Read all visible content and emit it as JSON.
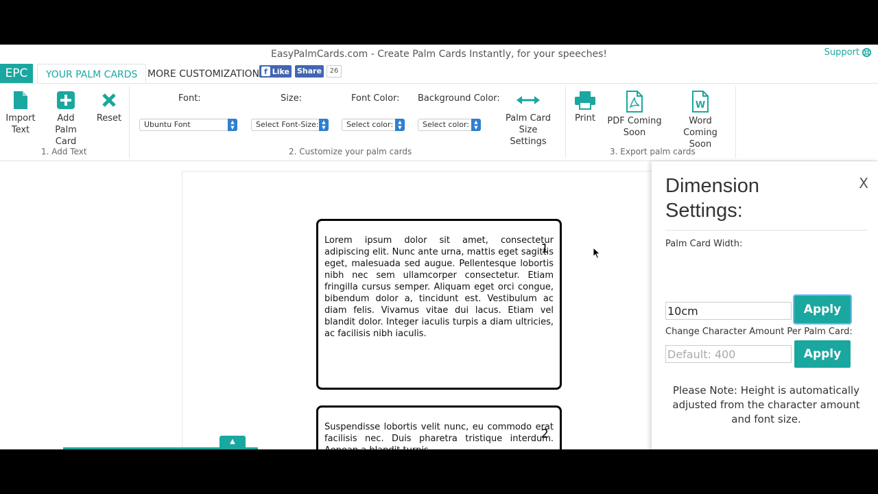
{
  "window": {
    "title": "EasyPalmCards.com - Create Palm Cards Instantly, for your speeches!",
    "support_label": "Support"
  },
  "tabs": {
    "logo": "EPC",
    "items": [
      {
        "label": "YOUR PALM CARDS",
        "active": true
      },
      {
        "label": "MORE CUSTOMIZATION",
        "active": false
      }
    ],
    "facebook": {
      "like": "Like",
      "share": "Share",
      "count": "26"
    }
  },
  "ribbon": {
    "add_text_group": {
      "label": "1. Add Text",
      "tools": [
        {
          "label": "Import Text",
          "icon": "file-icon"
        },
        {
          "label": "Add Palm Card",
          "icon": "plus-square-icon"
        },
        {
          "label": "Reset",
          "icon": "x-icon"
        }
      ]
    },
    "customize_group": {
      "label": "2. Customize your palm cards",
      "font": {
        "label": "Font:",
        "value": "Ubuntu Font"
      },
      "size": {
        "label": "Size:",
        "value": "Select Font-Size:"
      },
      "font_color": {
        "label": "Font Color:",
        "value": "Select color:"
      },
      "background_color": {
        "label": "Background Color:",
        "value": "Select color:"
      },
      "size_settings": {
        "label": "Palm Card Size Settings",
        "icon": "arrows-horizontal-icon"
      }
    },
    "export_group": {
      "label": "3. Export palm cards",
      "tools": [
        {
          "label": "Print",
          "icon": "print-icon"
        },
        {
          "label": "PDF Coming Soon",
          "icon": "pdf-file-icon"
        },
        {
          "label": "Word Coming Soon",
          "icon": "word-file-icon"
        }
      ]
    }
  },
  "cards": [
    {
      "number": "1",
      "text": "Lorem ipsum dolor sit amet, consectetur adipiscing elit. Nunc ante urna, mattis eget sagittis eget, malesuada sed augue. Pellentesque lobortis nibh nec sem ullamcorper consectetur. Etiam fringilla cursus semper. Aliquam eget orci congue, bibendum dolor a, tincidunt est. Vestibulum ac diam felis. Vivamus vitae dui lacus. Etiam vel blandit dolor. Integer iaculis turpis a diam ultricies, ac facilisis nibh iaculis."
    },
    {
      "number": "2",
      "text": "Suspendisse lobortis velit nunc, eu commodo erat facilisis nec. Duis pharetra tristique interdum. Aenean a blandit turpis"
    }
  ],
  "panel": {
    "title": "Dimension Settings:",
    "close_label": "X",
    "width_label": "Palm Card Width:",
    "width_value": "10cm",
    "char_label": "Change Character Amount Per Palm Card:",
    "char_placeholder": "Default: 400",
    "apply_label": "Apply",
    "note": "Please Note: Height is automatically adjusted from the character amount and font size."
  },
  "colors": {
    "accent": "#1aa79f",
    "facebook": "#4267b2",
    "select_arrow": "#2f7fd0"
  }
}
